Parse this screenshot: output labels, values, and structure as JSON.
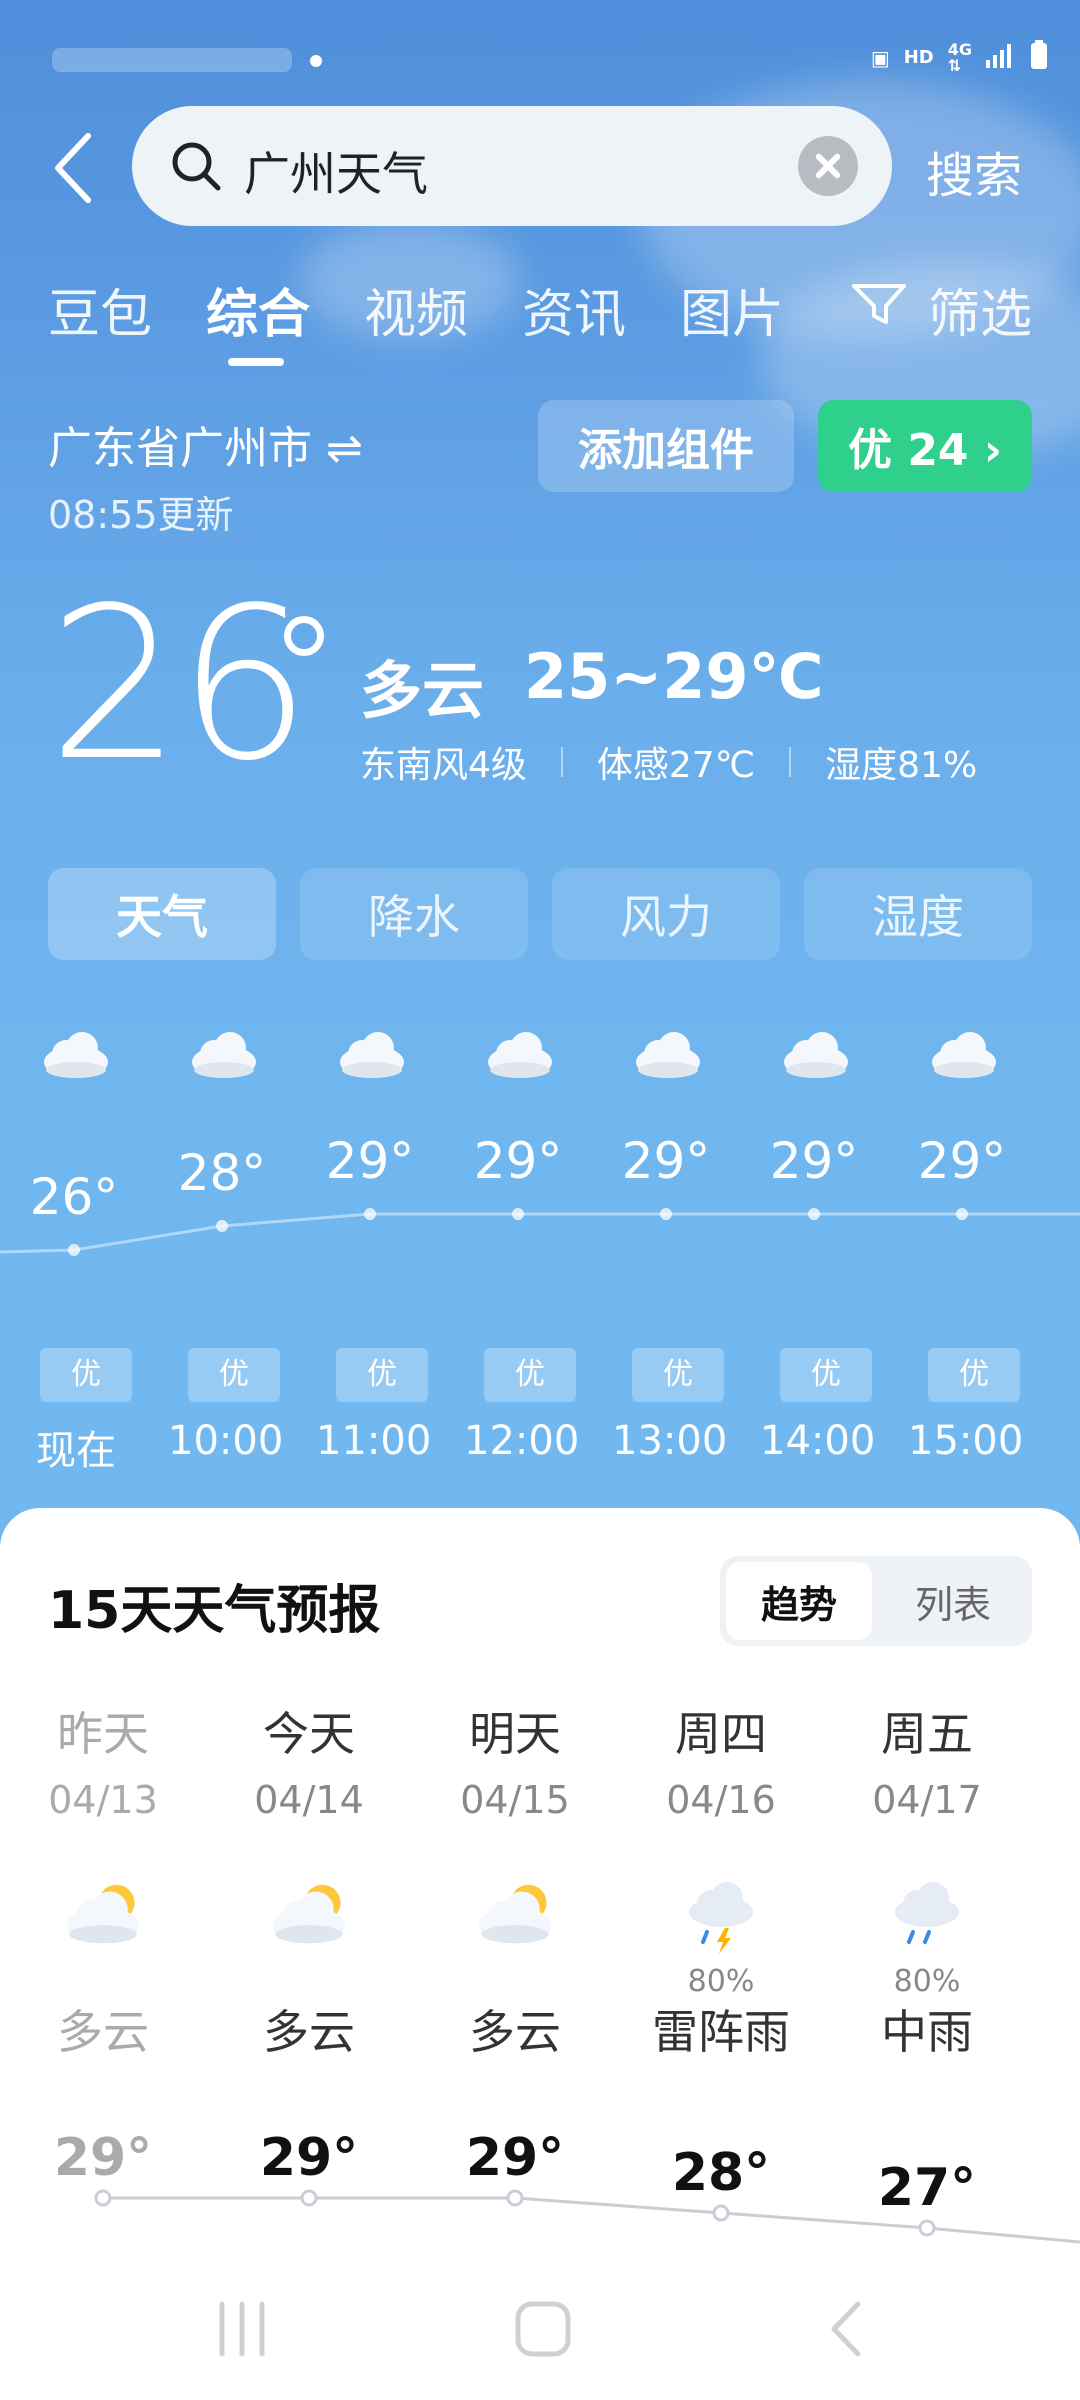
{
  "search": {
    "query": "广州天气",
    "button_label": "搜索"
  },
  "tabs": [
    {
      "label": "豆包"
    },
    {
      "label": "综合"
    },
    {
      "label": "视频"
    },
    {
      "label": "资讯"
    },
    {
      "label": "图片"
    },
    {
      "label": "筛选"
    }
  ],
  "location": {
    "name": "广东省广州市 ⇌",
    "updated": "08:55更新",
    "add_widget_label": "添加组件",
    "aqi_label": "优 24 ›"
  },
  "current": {
    "temp": "26",
    "condition": "多云",
    "range": "25~29℃",
    "wind": "东南风4级",
    "feels": "体感27℃",
    "humidity": "湿度81%"
  },
  "segment": [
    "天气",
    "降水",
    "风力",
    "湿度"
  ],
  "hourly": [
    {
      "time": "现在",
      "temp": 26,
      "temp_label": "26°",
      "aqi": "优"
    },
    {
      "time": "10:00",
      "temp": 28,
      "temp_label": "28°",
      "aqi": "优"
    },
    {
      "time": "11:00",
      "temp": 29,
      "temp_label": "29°",
      "aqi": "优"
    },
    {
      "time": "12:00",
      "temp": 29,
      "temp_label": "29°",
      "aqi": "优"
    },
    {
      "time": "13:00",
      "temp": 29,
      "temp_label": "29°",
      "aqi": "优"
    },
    {
      "time": "14:00",
      "temp": 29,
      "temp_label": "29°",
      "aqi": "优"
    },
    {
      "time": "15:00",
      "temp": 29,
      "temp_label": "29°",
      "aqi": "优"
    }
  ],
  "forecast": {
    "title": "15天天气预报",
    "toggle": [
      "趋势",
      "列表"
    ],
    "days": [
      {
        "name": "昨天",
        "date": "04/13",
        "icon": "partly-cloudy-icon",
        "precip": "",
        "condition": "多云",
        "high": 29,
        "high_label": "29°"
      },
      {
        "name": "今天",
        "date": "04/14",
        "icon": "partly-cloudy-icon",
        "precip": "",
        "condition": "多云",
        "high": 29,
        "high_label": "29°"
      },
      {
        "name": "明天",
        "date": "04/15",
        "icon": "partly-cloudy-icon",
        "precip": "",
        "condition": "多云",
        "high": 29,
        "high_label": "29°"
      },
      {
        "name": "周四",
        "date": "04/16",
        "icon": "thunderstorm-icon",
        "precip": "80%",
        "condition": "雷阵雨",
        "high": 28,
        "high_label": "28°"
      },
      {
        "name": "周五",
        "date": "04/17",
        "icon": "rain-icon",
        "precip": "80%",
        "condition": "中雨",
        "high": 27,
        "high_label": "27°"
      }
    ]
  }
}
